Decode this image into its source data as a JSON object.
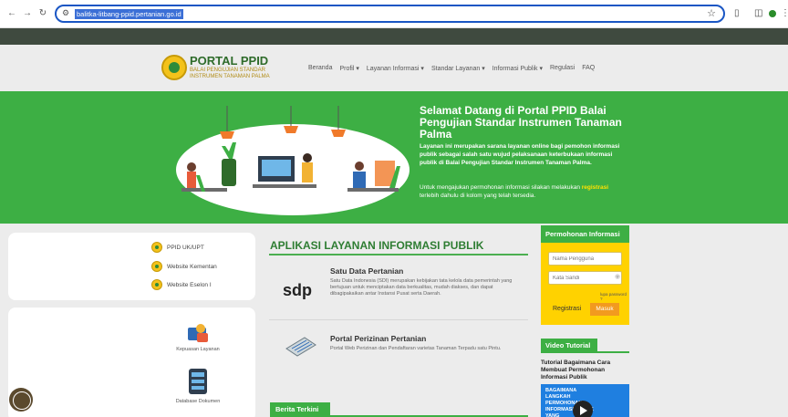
{
  "browser": {
    "url": "balitka-litbang-ppid.pertanian.go.id"
  },
  "header": {
    "brand_title": "PORTAL PPID",
    "brand_sub": "BALAI PENGUJIAN STANDAR INSTRUMEN TANAMAN PALMA",
    "menu": [
      "Beranda",
      "Profil ▾",
      "Layanan Informasi ▾",
      "Standar Layanan ▾",
      "Informasi Publik ▾",
      "Regulasi",
      "FAQ"
    ]
  },
  "hero": {
    "title": "Selamat Datang di Portal PPID Balai Pengujian Standar Instrumen Tanaman Palma",
    "description": "Layanan ini merupakan sarana layanan online bagi pemohon informasi publik sebagai salah satu wujud pelaksanaan keterbukaan informasi publik di Balai Pengujian Standar Instrumen Tanaman Palma.",
    "note_before": "Untuk mengajukan permohonan informasi silakan melakukan ",
    "note_link": "registrasi",
    "note_after": " terlebih dahulu di kolom yang telah tersedia."
  },
  "left": {
    "links": [
      "PPID UK/UPT",
      "Website Kementan",
      "Website Eselon I"
    ],
    "services": [
      "Kepuasan Layanan",
      "Database Dokumen"
    ]
  },
  "main": {
    "section_title": "APLIKASI LAYANAN INFORMASI PUBLIK",
    "apps": [
      {
        "logo_text": "sdp",
        "title": "Satu Data Pertanian",
        "description": "Satu Data Indonesia (SDI) merupakan kebijakan tata kelola data pemerintah yang bertujuan untuk menciptakan data berkualitas, mudah diakses, dan dapat dibagipakaikan antar Instansi Pusat serta Daerah."
      },
      {
        "title": "Portal Perizinan Pertanian",
        "description": "Portal Web Perizinan dan Pendaftaran varietas Tanaman Terpadu satu Pintu."
      }
    ],
    "news_tab": "Berita Terkini"
  },
  "login": {
    "heading": "Permohonan Informasi",
    "username_placeholder": "Nama Pengguna",
    "password_placeholder": "Kata Sandi",
    "forgot": "lupa password ?",
    "register": "Registrasi",
    "submit": "Masuk"
  },
  "video": {
    "heading": "Video Tutorial",
    "title": "Tutorial Bagaimana Cara Membuat Permohonan Informasi Publik",
    "thumb_text": "BAGAIMANA LANGKAH PERMOHONAN INFORMASI PUBLIK YANG"
  },
  "colors": {
    "brand_green": "#3daf44",
    "accent_yellow": "#ffd200",
    "button_orange": "#f29a1f"
  }
}
